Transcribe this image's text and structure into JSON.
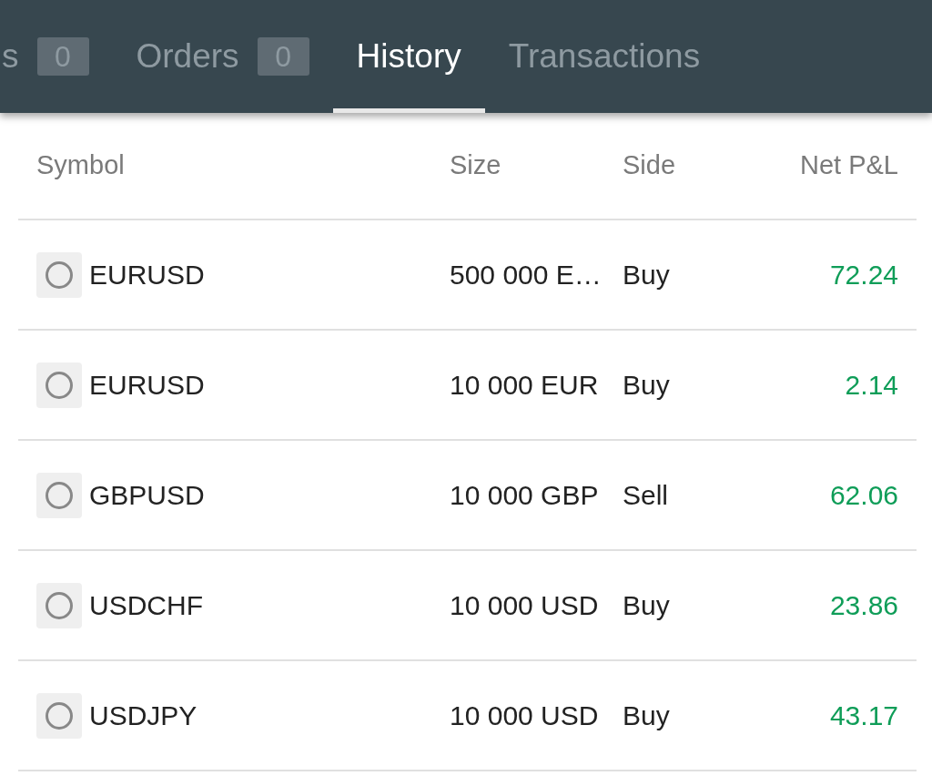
{
  "tabs": [
    {
      "label": "s",
      "badge": "0",
      "selected": false
    },
    {
      "label": "Orders",
      "badge": "0",
      "selected": false
    },
    {
      "label": "History",
      "selected": true
    },
    {
      "label": "Transactions",
      "selected": false
    }
  ],
  "table": {
    "columns": [
      "Symbol",
      "Size",
      "Side",
      "Net P&L"
    ],
    "rows": [
      {
        "selected": false,
        "symbol": "EURUSD",
        "size": "500 000 E…",
        "side": "Buy",
        "net_pl": "72.24"
      },
      {
        "selected": false,
        "symbol": "EURUSD",
        "size": "10 000 EUR",
        "side": "Buy",
        "net_pl": "2.14"
      },
      {
        "selected": false,
        "symbol": "GBPUSD",
        "size": "10 000 GBP",
        "side": "Sell",
        "net_pl": "62.06"
      },
      {
        "selected": false,
        "symbol": "USDCHF",
        "size": "10 000 USD",
        "side": "Buy",
        "net_pl": "23.86"
      },
      {
        "selected": false,
        "symbol": "USDJPY",
        "size": "10 000 USD",
        "side": "Buy",
        "net_pl": "43.17"
      }
    ]
  }
}
